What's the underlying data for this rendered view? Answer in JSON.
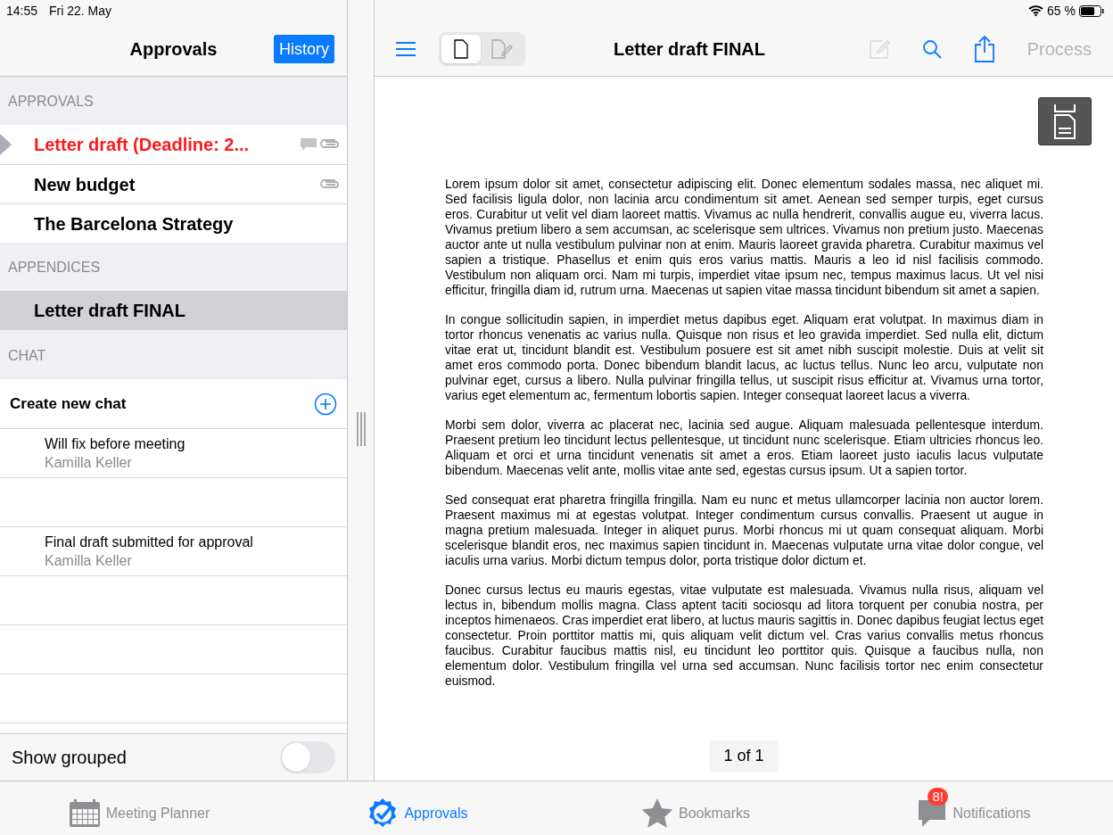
{
  "status_bar": {
    "time": "14:55",
    "date": "Fri 22. May",
    "battery": "65 %"
  },
  "sidebar": {
    "title": "Approvals",
    "history_button": "History",
    "sections": [
      {
        "header": "APPROVALS",
        "items": [
          {
            "title": "Letter draft (Deadline: 2...",
            "overdue": true,
            "selected": false,
            "current": true,
            "has_comment": true,
            "has_attachment": true
          },
          {
            "title": "New budget",
            "overdue": false,
            "selected": false,
            "current": false,
            "has_comment": false,
            "has_attachment": true
          },
          {
            "title": "The Barcelona Strategy",
            "overdue": false,
            "selected": false,
            "current": false,
            "has_comment": false,
            "has_attachment": false
          }
        ]
      },
      {
        "header": "APPENDICES",
        "items": [
          {
            "title": "Letter draft FINAL",
            "overdue": false,
            "selected": true,
            "current": false,
            "has_comment": false,
            "has_attachment": false
          }
        ]
      }
    ],
    "chat": {
      "header": "CHAT",
      "create_label": "Create new chat",
      "rows": [
        {
          "kind": "message",
          "message": "Will fix before meeting",
          "author": "Kamilla Keller"
        },
        {
          "kind": "blank"
        },
        {
          "kind": "message",
          "message": "Final draft submitted for approval",
          "author": "Kamilla Keller"
        },
        {
          "kind": "blank"
        },
        {
          "kind": "blank"
        },
        {
          "kind": "blank"
        }
      ]
    },
    "show_grouped": {
      "label": "Show grouped",
      "on": false
    }
  },
  "document": {
    "title": "Letter draft FINAL",
    "view_modes": [
      {
        "kind": "page",
        "selected": true
      },
      {
        "kind": "annotate",
        "selected": false
      }
    ],
    "edit_disabled": true,
    "process_button": {
      "label": "Process",
      "disabled": true
    },
    "paragraphs": [
      "Lorem ipsum dolor sit amet, consectetur adipiscing elit. Donec elementum sodales massa, nec aliquet mi. Sed facilisis ligula dolor, non lacinia arcu condimentum sit amet. Aenean sed semper turpis, eget cursus eros. Curabitur ut velit vel diam laoreet mattis. Vivamus ac nulla hendrerit, convallis augue eu, viverra lacus. Vivamus pretium libero a sem accumsan, ac scelerisque sem ultrices. Vivamus non pretium justo. Maecenas auctor ante ut nulla vestibulum pulvinar non at enim. Mauris laoreet gravida pharetra. Curabitur maximus vel sapien a tristique. Phasellus et enim quis eros varius mattis. Mauris a leo id nisl facilisis commodo. Vestibulum non aliquam orci. Nam mi turpis, imperdiet vitae ipsum nec, tempus maximus lacus. Ut vel nisi efficitur, fringilla diam id, rutrum urna. Maecenas ut sapien vitae massa tincidunt bibendum sit amet a sapien.",
      "In congue sollicitudin sapien, in imperdiet metus dapibus eget. Aliquam erat volutpat. In maximus diam in tortor rhoncus venenatis ac varius nulla. Quisque non risus et leo gravida imperdiet. Sed nulla elit, dictum vitae erat ut, tincidunt blandit est. Vestibulum posuere est sit amet nibh suscipit molestie. Duis at velit sit amet eros commodo porta. Donec bibendum blandit lacus, ac luctus tellus. Nunc leo arcu, vulputate non pulvinar eget, cursus a libero. Nulla pulvinar fringilla tellus, ut suscipit risus efficitur at. Vivamus urna tortor, varius eget elementum ac, fermentum lobortis sapien. Integer consequat laoreet lacus a viverra.",
      "Morbi sem dolor, viverra ac placerat nec, lacinia sed augue. Aliquam malesuada pellentesque interdum. Praesent pretium leo tincidunt lectus pellentesque, ut tincidunt nunc scelerisque. Etiam ultricies rhoncus leo. Aliquam et orci et urna tincidunt venenatis sit amet a eros. Etiam laoreet justo iaculis lacus vulputate bibendum. Maecenas velit ante, mollis vitae ante sed, egestas cursus ipsum. Ut a sapien tortor.",
      "Sed consequat erat pharetra fringilla fringilla. Nam eu nunc et metus ullamcorper lacinia non auctor lorem. Praesent maximus mi at egestas volutpat. Integer condimentum cursus convallis. Praesent ut augue in magna pretium malesuada. Integer in aliquet purus. Morbi rhoncus mi ut quam consequat aliquam. Morbi scelerisque blandit eros, nec maximus sapien tincidunt in. Maecenas vulputate urna vitae dolor congue, vel iaculis urna varius. Morbi dictum tempus dolor, porta tristique dolor dictum et.",
      "Donec cursus lectus eu mauris egestas, vitae vulputate est malesuada. Vivamus nulla risus, aliquam vel lectus in, bibendum mollis magna. Class aptent taciti sociosqu ad litora torquent per conubia nostra, per inceptos himenaeos. Cras imperdiet erat libero, at luctus mauris sagittis in. Donec dapibus feugiat lectus eget consectetur. Proin porttitor mattis mi, quis aliquam velit dictum vel. Cras varius convallis metus rhoncus faucibus. Curabitur faucibus mattis nisl, eu tincidunt leo porttitor quis. Quisque a faucibus nulla, non elementum dolor. Vestibulum fringilla vel urna sed accumsan. Nunc facilisis tortor nec enim consectetur euismod."
    ],
    "page_indicator": "1 of 1"
  },
  "tab_bar": [
    {
      "kind": "calendar",
      "label": "Meeting Planner",
      "selected": false
    },
    {
      "kind": "approval",
      "label": "Approvals",
      "selected": true
    },
    {
      "kind": "star",
      "label": "Bookmarks",
      "selected": false
    },
    {
      "kind": "chat",
      "label": "Notifications",
      "selected": false,
      "badge": "8!"
    }
  ]
}
